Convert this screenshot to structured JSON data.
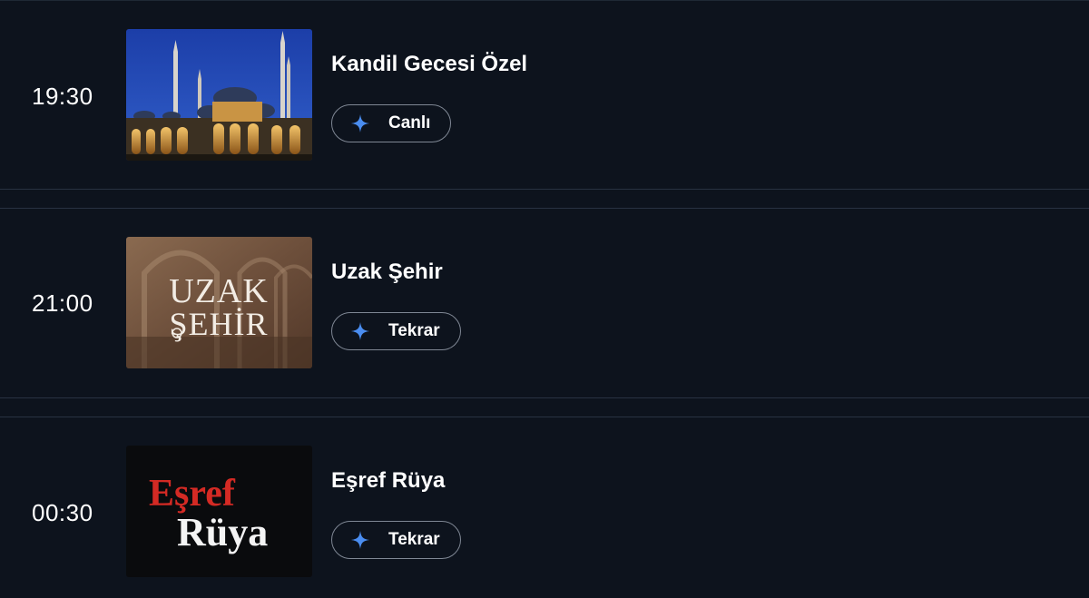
{
  "schedule": [
    {
      "time": "19:30",
      "title": "Kandil Gecesi Özel",
      "badge": "Canlı",
      "thumbnail": "mosque-night-image"
    },
    {
      "time": "21:00",
      "title": "Uzak Şehir",
      "badge": "Tekrar",
      "thumbnail": "uzak-sehir-poster",
      "thumbnail_text": [
        "UZAK",
        "ŞEHİR"
      ]
    },
    {
      "time": "00:30",
      "title": "Eşref Rüya",
      "badge": "Tekrar",
      "thumbnail": "esref-ruya-poster",
      "thumbnail_text": [
        "Eşref",
        "Rüya"
      ]
    }
  ],
  "colors": {
    "background": "#0d131d",
    "divider": "#283241",
    "badge_border": "#7f8794",
    "sparkle": "#4a8df0",
    "esref_red": "#d42a24"
  },
  "icons": {
    "badge_icon": "sparkle-icon"
  }
}
